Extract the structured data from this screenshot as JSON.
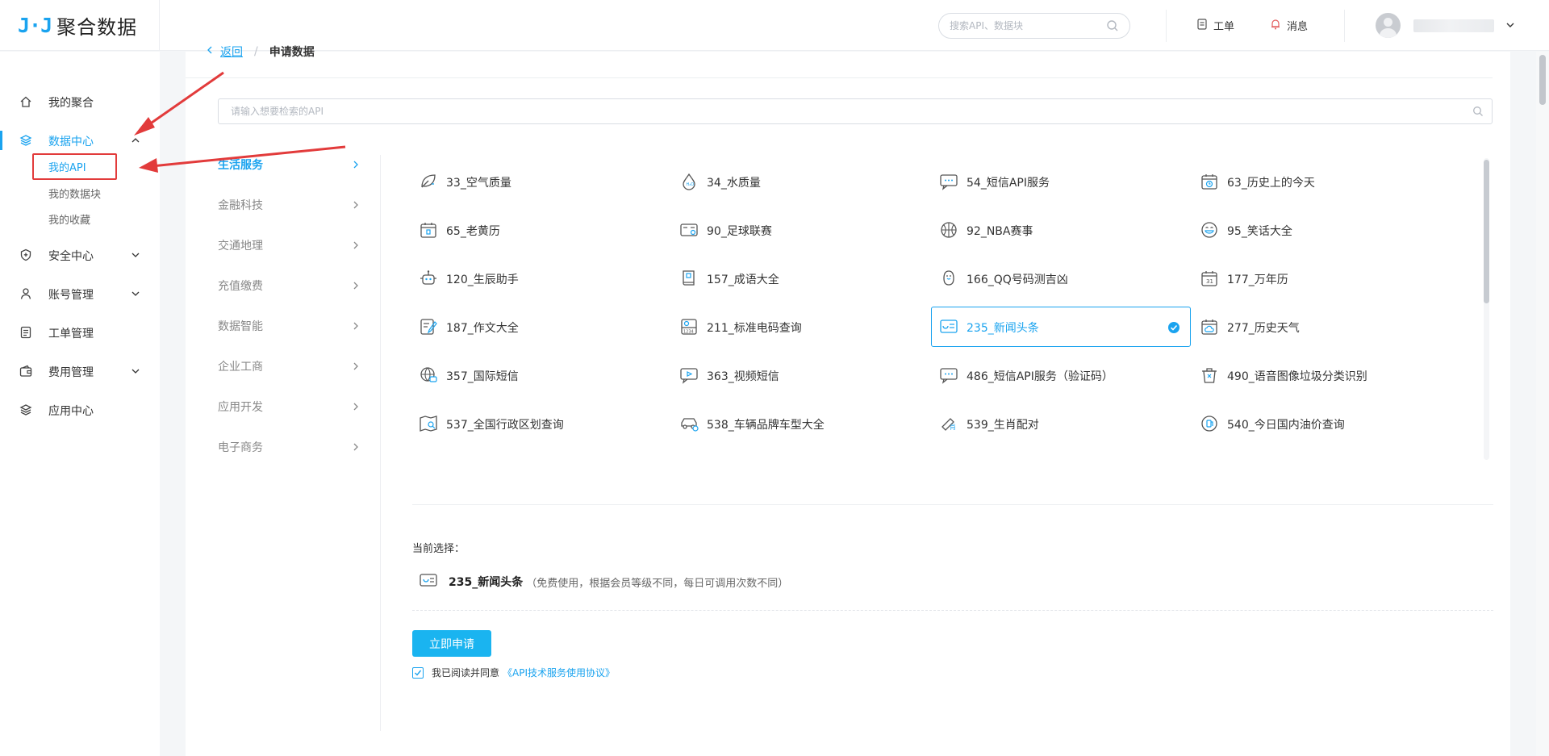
{
  "brand": {
    "mark": "J·J",
    "name": "聚合数据"
  },
  "header": {
    "search_placeholder": "搜索API、数据块",
    "workorder_label": "工单",
    "messages_label": "消息"
  },
  "sidebar": {
    "items": [
      {
        "label": "我的聚合",
        "icon": "home-icon"
      },
      {
        "label": "数据中心",
        "icon": "layers-icon"
      },
      {
        "label": "安全中心",
        "icon": "shield-icon"
      },
      {
        "label": "账号管理",
        "icon": "user-icon"
      },
      {
        "label": "工单管理",
        "icon": "document-icon"
      },
      {
        "label": "费用管理",
        "icon": "wallet-icon"
      },
      {
        "label": "应用中心",
        "icon": "stack-icon"
      }
    ],
    "sub_items": [
      "我的API",
      "我的数据块",
      "我的收藏"
    ]
  },
  "breadcrumb": {
    "back": "返回",
    "current": "申请数据"
  },
  "api_search_placeholder": "请输入想要检索的API",
  "categories": [
    "生活服务",
    "金融科技",
    "交通地理",
    "充值缴费",
    "数据智能",
    "企业工商",
    "应用开发",
    "电子商务"
  ],
  "apis": [
    {
      "label": "33_空气质量",
      "icon": "leaf-icon"
    },
    {
      "label": "34_水质量",
      "icon": "water-drop-icon"
    },
    {
      "label": "54_短信API服务",
      "icon": "chat-icon"
    },
    {
      "label": "63_历史上的今天",
      "icon": "calendar-clock-icon"
    },
    {
      "label": "65_老黄历",
      "icon": "calendar-icon"
    },
    {
      "label": "90_足球联赛",
      "icon": "scoreboard-icon"
    },
    {
      "label": "92_NBA赛事",
      "icon": "basketball-icon"
    },
    {
      "label": "95_笑话大全",
      "icon": "smile-icon"
    },
    {
      "label": "120_生辰助手",
      "icon": "robot-icon"
    },
    {
      "label": "157_成语大全",
      "icon": "book-icon"
    },
    {
      "label": "166_QQ号码测吉凶",
      "icon": "penguin-icon"
    },
    {
      "label": "177_万年历",
      "icon": "calendar-31-icon"
    },
    {
      "label": "187_作文大全",
      "icon": "edit-doc-icon"
    },
    {
      "label": "211_标准电码查询",
      "icon": "code-card-icon"
    },
    {
      "label": "235_新闻头条",
      "icon": "news-icon"
    },
    {
      "label": "277_历史天气",
      "icon": "cloud-calendar-icon"
    },
    {
      "label": "357_国际短信",
      "icon": "globe-chat-icon"
    },
    {
      "label": "363_视频短信",
      "icon": "video-chat-icon"
    },
    {
      "label": "486_短信API服务（验证码）",
      "icon": "chat-icon"
    },
    {
      "label": "490_语音图像垃圾分类识别",
      "icon": "trash-icon"
    },
    {
      "label": "537_全国行政区划查询",
      "icon": "map-search-icon"
    },
    {
      "label": "538_车辆品牌车型大全",
      "icon": "car-icon"
    },
    {
      "label": "539_生肖配对",
      "icon": "pair-icon"
    },
    {
      "label": "540_今日国内油价查询",
      "icon": "fuel-icon"
    }
  ],
  "selected_index": 14,
  "current_selection": {
    "label": "当前选择：",
    "name": "235_新闻头条",
    "note": "（免费使用，根据会员等级不同，每日可调用次数不同）"
  },
  "apply_button": "立即申请",
  "agreement": {
    "text": "我已阅读并同意",
    "link": "《API技术服务使用协议》",
    "checked": true
  },
  "colors": {
    "accent": "#1aa3ef",
    "button": "#1ab4f0",
    "annotation": "#e23b3b"
  }
}
